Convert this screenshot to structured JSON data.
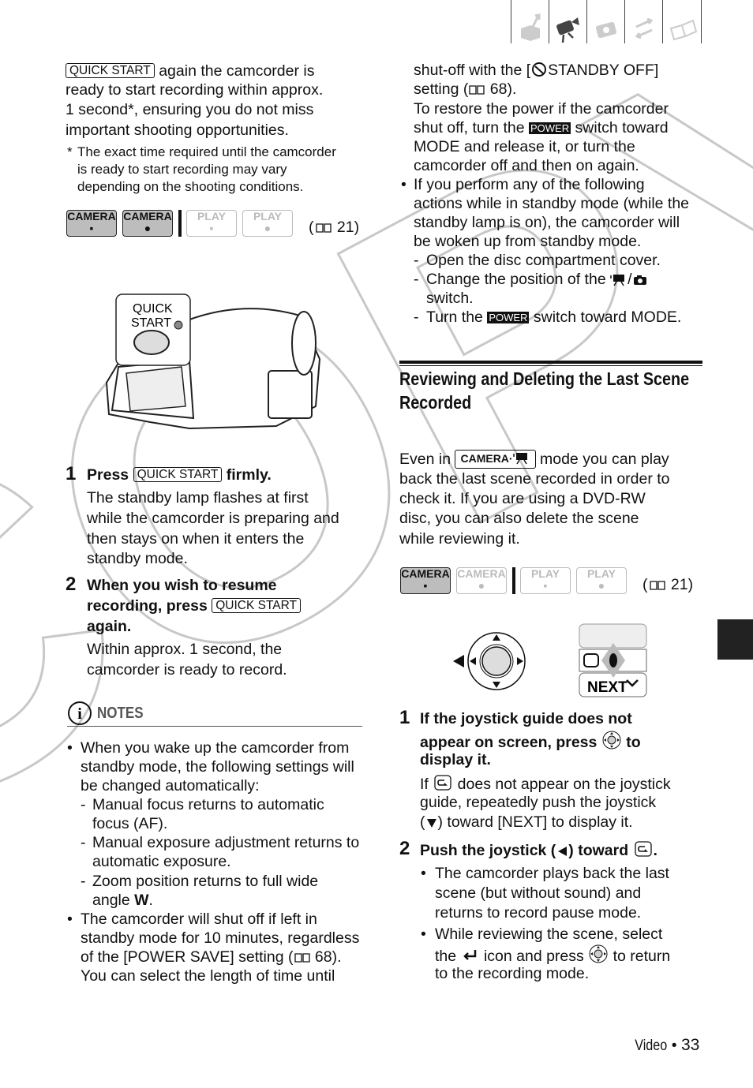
{
  "watermark": "COPY",
  "top_tabs": [
    {
      "icon": "package-arrow-icon",
      "active": false
    },
    {
      "icon": "movie-camera-icon",
      "active": true
    },
    {
      "icon": "camera-icon",
      "active": false
    },
    {
      "icon": "transfer-arrows-icon",
      "active": false
    },
    {
      "icon": "book-icon",
      "active": false
    }
  ],
  "modes": {
    "camera": "CAMERA",
    "play": "PLAY",
    "ref_left": "21",
    "ref_right": "21"
  },
  "illustration": {
    "label_line1": "QUICK",
    "label_line2": "START"
  },
  "joystick_guide": {
    "next": "NEXT"
  },
  "notes_label": "NOTES",
  "heading": [
    "Reviewing and Deleting the Last Scene",
    "Recorded"
  ],
  "step_numbers": [
    "1",
    "2"
  ],
  "left_lines": [
    [
      {
        "badge": "QUICK START"
      },
      " again the camcorder is"
    ],
    [
      "ready to start recording within approx."
    ],
    [
      "1 second*, ensuring you do not miss"
    ],
    [
      "important shooting opportunities."
    ],
    [
      "*"
    ],
    [
      "The exact time required until the camcorder"
    ],
    [
      "is ready to start recording may vary"
    ],
    [
      "depending on the shooting conditions."
    ],
    [
      "Press ",
      {
        "badge": "QUICK START"
      },
      " firmly."
    ],
    [
      "The standby lamp flashes at first"
    ],
    [
      "while the camcorder is preparing and"
    ],
    [
      "then stays on when it enters the"
    ],
    [
      "standby mode."
    ],
    [
      "When you wish to resume"
    ],
    [
      "recording, press ",
      {
        "badge": "QUICK START"
      }
    ],
    [
      "again."
    ],
    [
      "Within approx. 1 second, the"
    ],
    [
      "camcorder is ready to record."
    ],
    [
      "•"
    ],
    [
      "When you wake up the camcorder from"
    ],
    [
      "standby mode, the following settings will"
    ],
    [
      "be changed automatically:"
    ],
    [
      "-"
    ],
    [
      "Manual focus returns to automatic"
    ],
    [
      "focus (AF)."
    ],
    [
      "-"
    ],
    [
      "Manual exposure adjustment returns to"
    ],
    [
      "automatic exposure."
    ],
    [
      "-"
    ],
    [
      "Zoom position returns to full wide"
    ],
    [
      "angle ",
      {
        "bold": "W"
      },
      "."
    ],
    [
      "•"
    ],
    [
      "The camcorder will shut off if left in"
    ],
    [
      "standby mode for 10 minutes, regardless"
    ],
    [
      "of the [POWER SAVE] setting (",
      {
        "icon": "book-icon"
      },
      " 68)."
    ],
    [
      "You can select the length of time until"
    ]
  ],
  "right_lines": [
    [
      "shut-off with the [",
      {
        "icon": "standby-off-icon"
      },
      "STANDBY OFF]"
    ],
    [
      "setting (",
      {
        "icon": "book-icon"
      },
      " 68)."
    ],
    [
      "To restore the power if the camcorder"
    ],
    [
      "shut off, turn the ",
      {
        "power": "POWER"
      },
      " switch toward"
    ],
    [
      "MODE and release it, or turn the"
    ],
    [
      "camcorder off and then on again."
    ],
    [
      "•"
    ],
    [
      "If you perform any of the following"
    ],
    [
      "actions while in standby mode (while the"
    ],
    [
      "standby lamp is on), the camcorder will"
    ],
    [
      "be woken up from standby mode."
    ],
    [
      "-"
    ],
    [
      "Open the disc compartment cover."
    ],
    [
      "-"
    ],
    [
      "Change the position of the ",
      {
        "icon": "movie-icon"
      },
      "/",
      {
        "icon": "camera-icon"
      }
    ],
    [
      "switch."
    ],
    [
      "-"
    ],
    [
      "Turn the ",
      {
        "power": "POWER"
      },
      " switch toward MODE."
    ],
    [
      "Even in ",
      {
        "modebadge": "CAMERA·"
      },
      " mode you can play"
    ],
    [
      "back the last scene recorded in order to"
    ],
    [
      "check it. If you are using a DVD-RW"
    ],
    [
      "disc, you can also delete the scene"
    ],
    [
      "while reviewing it."
    ],
    [
      "If the joystick guide does not"
    ],
    [
      "appear on screen, press ",
      {
        "icon": "joystick-icon"
      },
      " to"
    ],
    [
      "display it."
    ],
    [
      "If ",
      {
        "icon": "playback-icon"
      },
      " does not appear on the joystick"
    ],
    [
      "guide, repeatedly push the joystick"
    ],
    [
      "(",
      {
        "icon": "arrow-down-icon"
      },
      ") toward [NEXT] to display it."
    ],
    [
      "Push the joystick (",
      {
        "icon": "arrow-left-icon"
      },
      ") toward ",
      {
        "icon": "playback-icon"
      },
      "."
    ],
    [
      "•"
    ],
    [
      "The camcorder plays back the last"
    ],
    [
      "scene (but without sound) and"
    ],
    [
      "returns to record pause mode."
    ],
    [
      "•"
    ],
    [
      "While reviewing the scene, select"
    ],
    [
      "the ",
      {
        "icon": "return-icon"
      },
      " icon and press ",
      {
        "icon": "joystick-icon"
      },
      " to return"
    ],
    [
      "to the recording mode."
    ]
  ],
  "footer": {
    "section": "Video",
    "bullet": "•",
    "page": "33"
  }
}
